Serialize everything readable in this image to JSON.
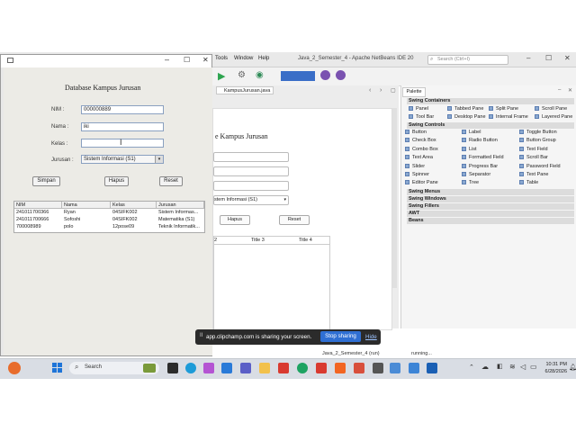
{
  "netbeans": {
    "menus": [
      "Tools",
      "Window",
      "Help"
    ],
    "title": "Java_2_Semester_4 - Apache NetBeans IDE 20",
    "search_placeholder": "Search (Ctrl+I)",
    "editor_tab": "KampusJurusan.java",
    "designer": {
      "title": "e Kampus Jurusan",
      "combo_text": "stem Informasi (S1)",
      "hapus": "Hapus",
      "reset": "Reset",
      "col3": "Title 3",
      "col4": "Title 4",
      "col1_partial": "2"
    },
    "palette": {
      "tab": "Palette",
      "categories": {
        "containers": "Swing Containers",
        "controls": "Swing Controls",
        "menus": "Swing Menus",
        "windows": "Swing Windows",
        "fillers": "Swing Fillers",
        "awt": "AWT",
        "beans": "Beans"
      },
      "containers": [
        "Panel",
        "Tabbed Pane",
        "Split Pane",
        "Scroll Pane",
        "Tool Bar",
        "Desktop Pane",
        "Internal Frame",
        "Layered Pane"
      ],
      "controls": [
        "Button",
        "Label",
        "Toggle Button",
        "Check Box",
        "Radio Button",
        "Button Group",
        "Combo Box",
        "List",
        "Text Field",
        "Text Area",
        "Formatted Field",
        "Scroll Bar",
        "Slider",
        "Progress Bar",
        "Password Field",
        "Spinner",
        "Separator",
        "Text Pane",
        "Editor Pane",
        "Tree",
        "Table"
      ]
    }
  },
  "form": {
    "title": "Database Kampus Jurusan",
    "labels": {
      "nim": "NIM :",
      "nama": "Nama :",
      "kelas": "Kelas :",
      "jurusan": "Jurusan :"
    },
    "values": {
      "nim": "000000889",
      "nama": "iki",
      "kelas": "",
      "jurusan": "Sistem Informasi (S1)"
    },
    "buttons": {
      "simpan": "Simpan",
      "hapus": "Hapus",
      "reset": "Reset"
    },
    "table": {
      "headers": [
        "NIM",
        "Nama",
        "Kelas",
        "Jurusan"
      ],
      "rows": [
        [
          "241011700366",
          "Ryan",
          "04SIFK002",
          "Sistem Informas..."
        ],
        [
          "241011700666",
          "Sofoshi",
          "04SIFK002",
          "Matematika (S1)"
        ],
        [
          "700008989",
          "polo",
          "12pose09",
          "Teknik Informatik..."
        ]
      ]
    }
  },
  "share_banner": {
    "text": "app.clipchamp.com is sharing your screen.",
    "stop": "Stop sharing",
    "hide": "Hide"
  },
  "taskbar": {
    "search": "Search",
    "running_app": "Java_2_Semester_4 (run)",
    "running_status": "running...",
    "time": "10:31 PM",
    "date": "6/28/2026"
  }
}
